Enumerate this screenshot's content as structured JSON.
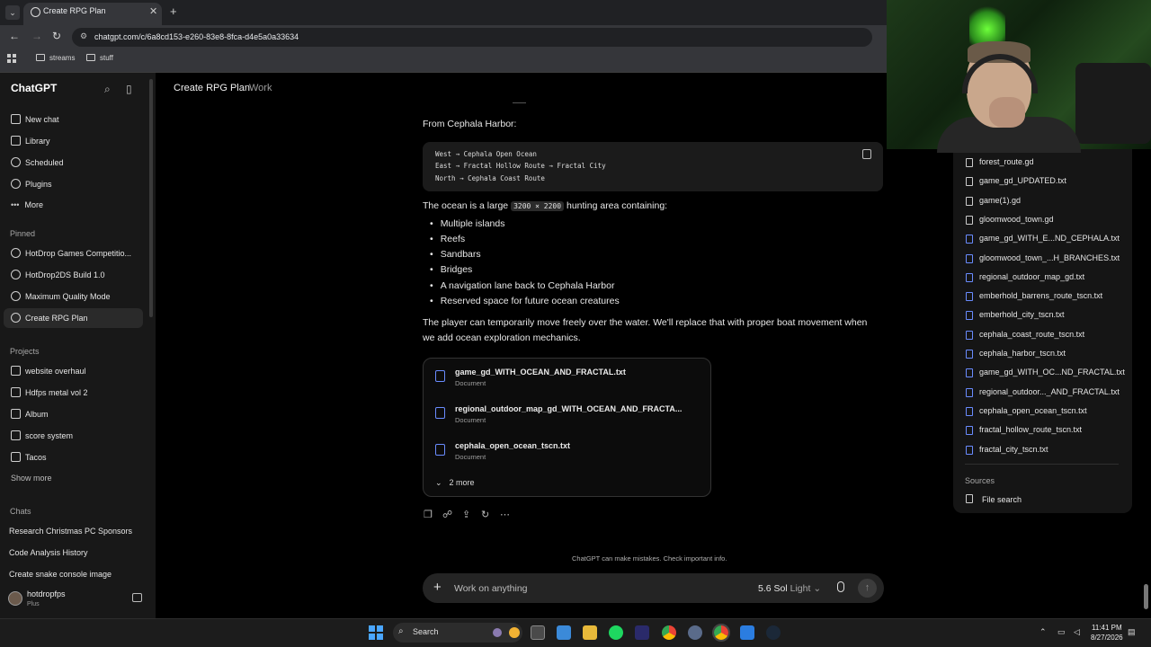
{
  "browser": {
    "tab_title": "Create RPG Plan",
    "url": "chatgpt.com/c/6a8cd153-e260-83e8-8fca-d4e5a0a33634",
    "bookmarks": [
      "streams",
      "stuff"
    ]
  },
  "sidebar": {
    "brand": "ChatGPT",
    "nav": [
      "New chat",
      "Library",
      "Scheduled",
      "Plugins",
      "More"
    ],
    "pinned_heading": "Pinned",
    "pinned": [
      "HotDrop Games Competitio...",
      "HotDrop2DS Build 1.0",
      "Maximum Quality Mode",
      "Create RPG Plan"
    ],
    "projects_heading": "Projects",
    "projects": [
      "website overhaul",
      "Hdfps metal vol 2",
      "Album",
      "score system",
      "Tacos"
    ],
    "show_more": "Show more",
    "chats_heading": "Chats",
    "chats": [
      "Research Christmas PC Sponsors",
      "Code Analysis History",
      "Create snake console image"
    ],
    "user": {
      "name": "hotdropfps",
      "plan": "Plus"
    }
  },
  "header": {
    "title": "Create RPG Plan",
    "separator": "·",
    "project": "Work"
  },
  "message": {
    "intro": "From Cephala Harbor:",
    "code_lines": [
      "West → Cephala Open Ocean",
      "East → Fractal Hollow Route → Fractal City",
      "North → Cephala Coast Route"
    ],
    "ocean_before": "The ocean is a large",
    "ocean_code": "3200 × 2200",
    "ocean_after": "hunting area containing:",
    "bullets": [
      "Multiple islands",
      "Reefs",
      "Sandbars",
      "Bridges",
      "A navigation lane back to Cephala Harbor",
      "Reserved space for future ocean creatures"
    ],
    "para1": "The player can temporarily move freely over the water. We'll replace that with proper boat movement when",
    "para2": "we add ocean exploration mechanics.",
    "files": [
      {
        "name": "game_gd_WITH_OCEAN_AND_FRACTAL.txt",
        "type": "Document"
      },
      {
        "name": "regional_outdoor_map_gd_WITH_OCEAN_AND_FRACTA...",
        "type": "Document"
      },
      {
        "name": "cephala_open_ocean_tscn.txt",
        "type": "Document"
      }
    ],
    "more_files": "2 more"
  },
  "footer": {
    "disclaimer": "ChatGPT can make mistakes. Check important info.",
    "composer_placeholder": "Work on anything",
    "model": "5.6 Sol",
    "model_mode": "Light"
  },
  "right_panel": {
    "files": [
      {
        "name": "forest_route.gd",
        "color": "gray"
      },
      {
        "name": "game_gd_UPDATED.txt",
        "color": "gray"
      },
      {
        "name": "game(1).gd",
        "color": "gray"
      },
      {
        "name": "gloomwood_town.gd",
        "color": "gray"
      },
      {
        "name": "game_gd_WITH_E...ND_CEPHALA.txt",
        "color": "blue"
      },
      {
        "name": "gloomwood_town_...H_BRANCHES.txt",
        "color": "blue"
      },
      {
        "name": "regional_outdoor_map_gd.txt",
        "color": "blue"
      },
      {
        "name": "emberhold_barrens_route_tscn.txt",
        "color": "blue"
      },
      {
        "name": "emberhold_city_tscn.txt",
        "color": "blue"
      },
      {
        "name": "cephala_coast_route_tscn.txt",
        "color": "blue"
      },
      {
        "name": "cephala_harbor_tscn.txt",
        "color": "blue"
      },
      {
        "name": "game_gd_WITH_OC...ND_FRACTAL.txt",
        "color": "blue"
      },
      {
        "name": "regional_outdoor..._AND_FRACTAL.txt",
        "color": "blue"
      },
      {
        "name": "cephala_open_ocean_tscn.txt",
        "color": "blue"
      },
      {
        "name": "fractal_hollow_route_tscn.txt",
        "color": "blue"
      },
      {
        "name": "fractal_city_tscn.txt",
        "color": "blue"
      }
    ],
    "sources_heading": "Sources",
    "file_search": "File search"
  },
  "taskbar": {
    "search": "Search",
    "time": "11:41 PM",
    "date": "8/27/2026"
  },
  "colors": {
    "accent_blue": "#6a8cff",
    "windows_blue": "#4aa6ff"
  }
}
